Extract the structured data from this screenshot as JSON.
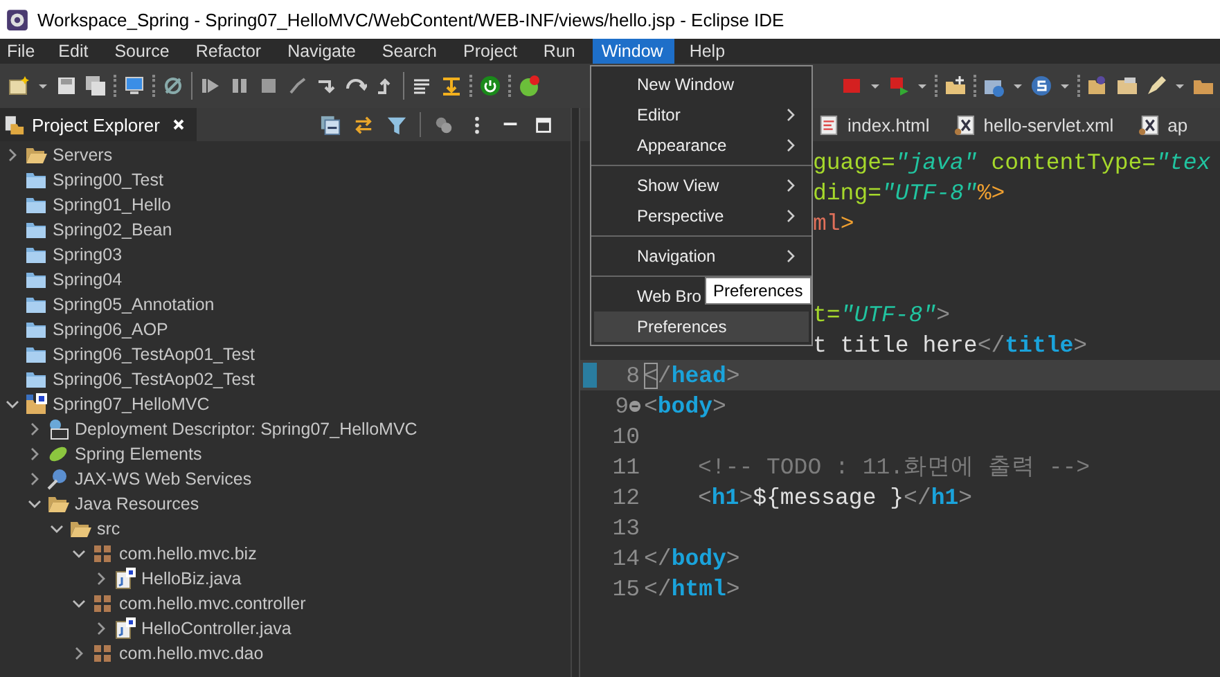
{
  "window": {
    "title": "Workspace_Spring - Spring07_HelloMVC/WebContent/WEB-INF/views/hello.jsp - Eclipse IDE"
  },
  "menu_bar": [
    {
      "label": "File",
      "selected": false
    },
    {
      "label": "Edit",
      "selected": false
    },
    {
      "label": "Source",
      "selected": false
    },
    {
      "label": "Refactor",
      "selected": false
    },
    {
      "label": "Navigate",
      "selected": false
    },
    {
      "label": "Search",
      "selected": false
    },
    {
      "label": "Project",
      "selected": false
    },
    {
      "label": "Run",
      "selected": false
    },
    {
      "label": "Window",
      "selected": true
    },
    {
      "label": "Help",
      "selected": false
    }
  ],
  "window_menu": {
    "items": [
      {
        "kind": "item",
        "label": "New Window",
        "submenu": false,
        "selected": false
      },
      {
        "kind": "item",
        "label": "Editor",
        "submenu": true,
        "selected": false
      },
      {
        "kind": "item",
        "label": "Appearance",
        "submenu": true,
        "selected": false
      },
      {
        "kind": "separator"
      },
      {
        "kind": "item",
        "label": "Show View",
        "submenu": true,
        "selected": false
      },
      {
        "kind": "item",
        "label": "Perspective",
        "submenu": true,
        "selected": false
      },
      {
        "kind": "separator"
      },
      {
        "kind": "item",
        "label": "Navigation",
        "submenu": true,
        "selected": false
      },
      {
        "kind": "separator"
      },
      {
        "kind": "item",
        "label": "Web Bro",
        "submenu": false,
        "selected": false
      },
      {
        "kind": "item",
        "label": "Preferences",
        "submenu": false,
        "selected": true
      }
    ]
  },
  "tooltip": {
    "text": "Preferences"
  },
  "project_explorer": {
    "title": "Project Explorer",
    "tree": [
      {
        "label": "Servers",
        "kind": "open-folder",
        "expanded": false
      },
      {
        "label": "Spring00_Test",
        "kind": "project"
      },
      {
        "label": "Spring01_Hello",
        "kind": "project"
      },
      {
        "label": "Spring02_Bean",
        "kind": "project"
      },
      {
        "label": "Spring03",
        "kind": "project"
      },
      {
        "label": "Spring04",
        "kind": "project"
      },
      {
        "label": "Spring05_Annotation",
        "kind": "project"
      },
      {
        "label": "Spring06_AOP",
        "kind": "project"
      },
      {
        "label": "Spring06_TestAop01_Test",
        "kind": "project"
      },
      {
        "label": "Spring06_TestAop02_Test",
        "kind": "project"
      },
      {
        "label": "Spring07_HelloMVC",
        "kind": "web-project",
        "expanded": true,
        "children": [
          {
            "label": "Deployment Descriptor: Spring07_HelloMVC",
            "kind": "descriptor",
            "expanded": false
          },
          {
            "label": "Spring Elements",
            "kind": "spring",
            "expanded": false
          },
          {
            "label": "JAX-WS Web Services",
            "kind": "webservice",
            "expanded": false
          },
          {
            "label": "Java Resources",
            "kind": "resources",
            "expanded": true,
            "children": [
              {
                "label": "src",
                "kind": "open-folder",
                "expanded": true,
                "children": [
                  {
                    "label": "com.hello.mvc.biz",
                    "kind": "package",
                    "expanded": true,
                    "children": [
                      {
                        "label": "HelloBiz.java",
                        "kind": "java-file",
                        "expanded": false
                      }
                    ]
                  },
                  {
                    "label": "com.hello.mvc.controller",
                    "kind": "package",
                    "expanded": true,
                    "children": [
                      {
                        "label": "HelloController.java",
                        "kind": "java-file",
                        "expanded": false
                      }
                    ]
                  },
                  {
                    "label": "com.hello.mvc.dao",
                    "kind": "package",
                    "expanded": false
                  }
                ]
              }
            ]
          }
        ]
      }
    ]
  },
  "editor": {
    "tabs": [
      {
        "label": "index.html",
        "kind": "html"
      },
      {
        "label": "hello-servlet.xml",
        "kind": "xml"
      },
      {
        "label": "ap",
        "kind": "xml"
      }
    ],
    "lines": [
      {
        "clipped": true,
        "segments": [
          {
            "kind": "attr",
            "text": "guage="
          },
          {
            "kind": "value",
            "text": "\"java\""
          },
          {
            "kind": "attr",
            "text": " contentType="
          },
          {
            "kind": "value",
            "text": "\"tex"
          }
        ]
      },
      {
        "clipped": true,
        "segments": [
          {
            "kind": "attr",
            "text": "ding="
          },
          {
            "kind": "value",
            "text": "\"UTF-8\""
          },
          {
            "kind": "directive",
            "text": "%>"
          }
        ]
      },
      {
        "clipped": true,
        "segments": [
          {
            "kind": "element",
            "text": "ml"
          },
          {
            "kind": "directive",
            "text": ">"
          }
        ]
      },
      {
        "clipped": true,
        "follows_hidden_lines": true,
        "segments": [
          {
            "kind": "attr",
            "text": "t="
          },
          {
            "kind": "value",
            "text": "\"UTF-8\""
          },
          {
            "kind": "bracket",
            "text": ">"
          }
        ]
      },
      {
        "clipped": true,
        "segments": [
          {
            "kind": "text",
            "text": "t title here"
          },
          {
            "kind": "bracket",
            "text": "</"
          },
          {
            "kind": "tag",
            "text": "title"
          },
          {
            "kind": "bracket",
            "text": ">"
          }
        ]
      },
      {
        "number": "8",
        "current": true,
        "marker": true,
        "segments": [
          {
            "kind": "bracket",
            "text": "<",
            "boxed": true
          },
          {
            "kind": "bracket",
            "text": "/"
          },
          {
            "kind": "tag",
            "text": "head"
          },
          {
            "kind": "bracket",
            "text": ">"
          }
        ]
      },
      {
        "number": "9",
        "fold": true,
        "segments": [
          {
            "kind": "bracket",
            "text": "<"
          },
          {
            "kind": "tag",
            "text": "body"
          },
          {
            "kind": "bracket",
            "text": ">"
          }
        ]
      },
      {
        "number": "10"
      },
      {
        "number": "11",
        "indented": true,
        "segments": [
          {
            "kind": "comment",
            "text": "<!-- TODO : 11.화면에 출력 -->"
          }
        ]
      },
      {
        "number": "12",
        "indented": true,
        "segments": [
          {
            "kind": "bracket",
            "text": "<"
          },
          {
            "kind": "tag",
            "text": "h1"
          },
          {
            "kind": "bracket",
            "text": ">"
          },
          {
            "kind": "text",
            "text": "${message }"
          },
          {
            "kind": "bracket",
            "text": "</"
          },
          {
            "kind": "tag",
            "text": "h1"
          },
          {
            "kind": "bracket",
            "text": ">"
          }
        ]
      },
      {
        "number": "13"
      },
      {
        "number": "14",
        "segments": [
          {
            "kind": "bracket",
            "text": "</"
          },
          {
            "kind": "tag",
            "text": "body"
          },
          {
            "kind": "bracket",
            "text": ">"
          }
        ]
      },
      {
        "number": "15",
        "segments": [
          {
            "kind": "bracket",
            "text": "</"
          },
          {
            "kind": "tag",
            "text": "html"
          },
          {
            "kind": "bracket",
            "text": ">"
          }
        ]
      }
    ]
  }
}
